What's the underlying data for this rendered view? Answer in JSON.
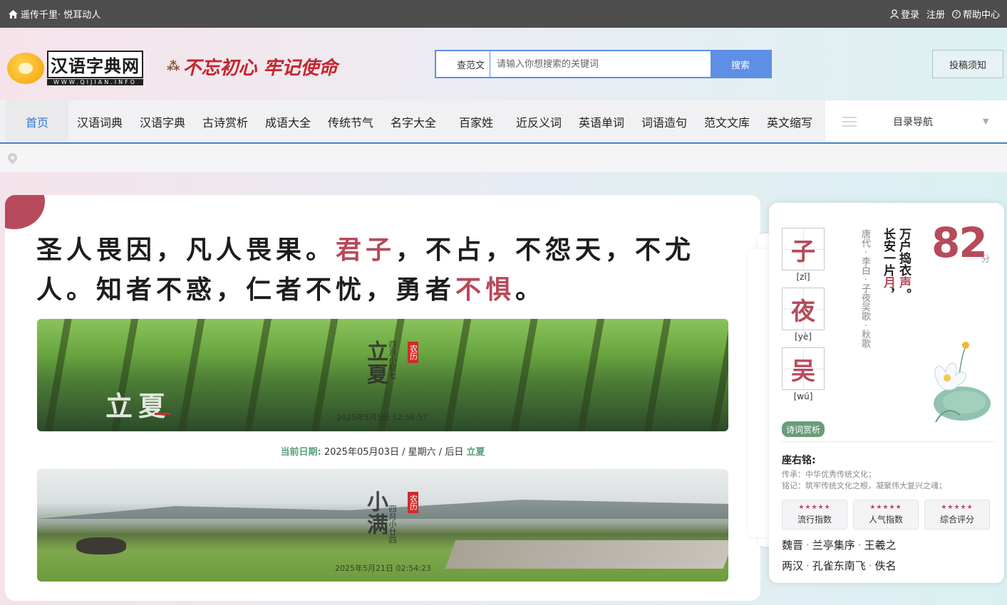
{
  "topbar": {
    "slogan": "遥传千里· 悦耳动人",
    "login": "登录",
    "register": "注册",
    "help": "帮助中心"
  },
  "header": {
    "logo_name": "汉语字典网",
    "logo_url": "WWW.QIJIAN.INFO",
    "motto": "不忘初心 牢记使命",
    "search": {
      "category": "查范文",
      "placeholder": "请输入你想搜索的关键词",
      "button": "搜索"
    },
    "submit_notice": "投稿须知"
  },
  "nav": {
    "home": "首页",
    "items": [
      "汉语词典",
      "汉语字典",
      "古诗赏析",
      "成语大全",
      "传统节气",
      "名字大全",
      "百家姓",
      "近反义词",
      "英语单词",
      "词语造句",
      "范文文库",
      "英文缩写"
    ],
    "catalog": "目录导航"
  },
  "quote": {
    "part1": "圣人畏因，凡人畏果。",
    "hl1": "君子",
    "part2": "，不占，不怨天，不尤人。知者不惑，仁者不忧，勇者",
    "hl2": "不惧",
    "part3": "。"
  },
  "solar_terms": [
    {
      "term": "立夏",
      "sub": "四月小初七",
      "badge": "农历",
      "date": "2025年5月5日 12:56:57",
      "big": "立夏"
    },
    {
      "term": "小满",
      "sub": "四月小廿四",
      "badge": "农历",
      "date": "2025年5月21日 02:54:23"
    }
  ],
  "current_date": {
    "label": "当前日期:",
    "value": "2025年05月03日 / 星期六 / 后日",
    "next_term": "立夏"
  },
  "poem": {
    "chars": [
      {
        "char": "子",
        "pinyin": "[zǐ]"
      },
      {
        "char": "夜",
        "pinyin": "[yè]"
      },
      {
        "char": "吴",
        "pinyin": "[wú]"
      }
    ],
    "meta": "唐代 · 李白 · 子夜吴歌 · 秋歌",
    "line1_a": "长安一片",
    "line1_hl": "月",
    "line1_b": "，",
    "line2_a": "万户捣衣",
    "line2_hl": "声",
    "line2_b": "。",
    "score": "82",
    "score_unit": "分",
    "tag": "诗词赏析"
  },
  "motto_section": {
    "title": "座右铭:",
    "line1": "传承：中华优秀传统文化；",
    "line2": "铭记：筑牢传统文化之根，凝聚伟大复兴之魂；"
  },
  "metrics": [
    {
      "stars": "★★★★★",
      "label": "流行指数"
    },
    {
      "stars": "★★★★★",
      "label": "人气指数"
    },
    {
      "stars": "★★★★★",
      "label": "综合评分"
    }
  ],
  "related": [
    {
      "dynasty": "魏晋",
      "work": "兰亭集序",
      "author": "王羲之"
    },
    {
      "dynasty": "两汉",
      "work": "孔雀东南飞",
      "author": "佚名"
    }
  ],
  "colors": {
    "accent": "#b74a5a",
    "link_blue": "#2f7ad8",
    "search_blue": "#5e8fe6",
    "green": "#58a07b"
  }
}
